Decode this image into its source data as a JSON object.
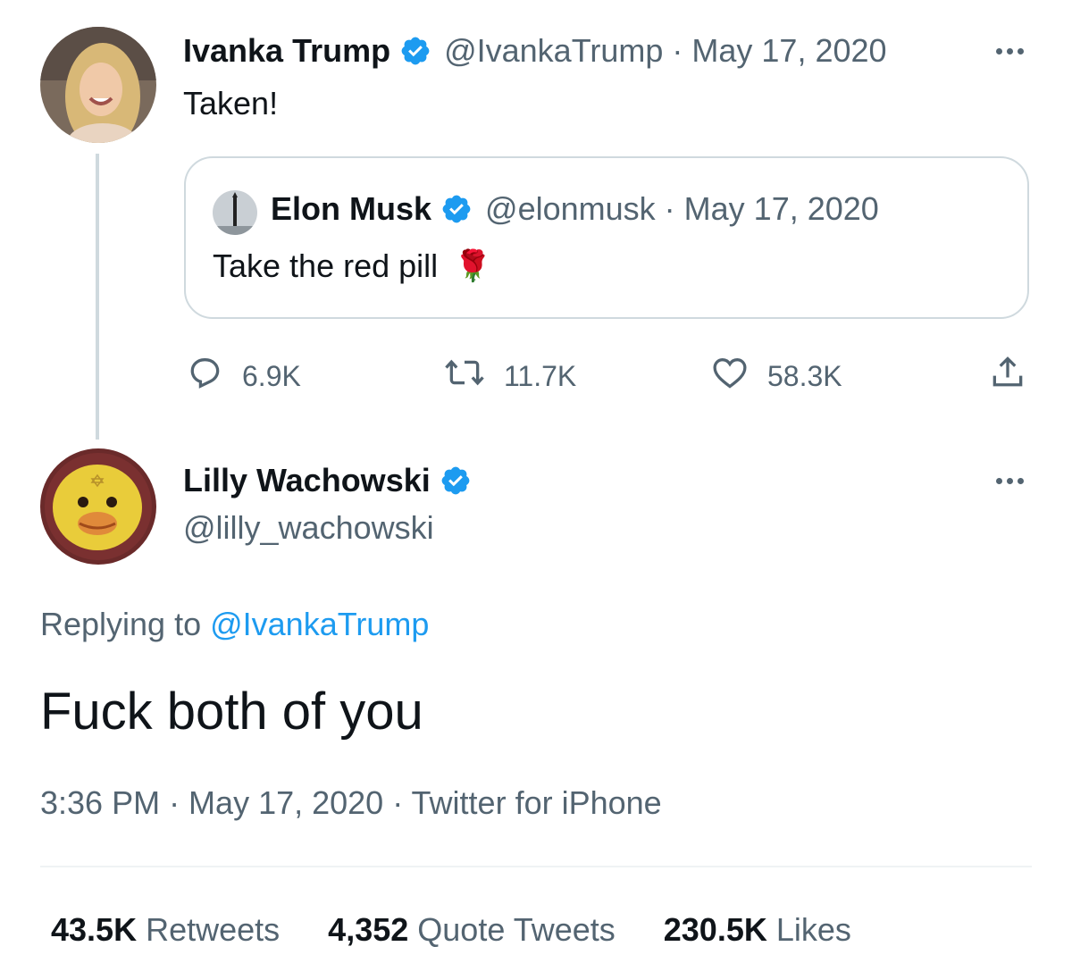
{
  "tweet_original": {
    "author_name": "Ivanka Trump",
    "handle": "@IvankaTrump",
    "separator": "·",
    "date": "May 17, 2020",
    "text": "Taken!",
    "quoted": {
      "author_name": "Elon Musk",
      "handle": "@elonmusk",
      "separator": "·",
      "date": "May 17, 2020",
      "text": "Take the red pill",
      "emoji": "🌹"
    },
    "actions": {
      "replies": "6.9K",
      "retweets": "11.7K",
      "likes": "58.3K"
    }
  },
  "tweet_reply": {
    "author_name": "Lilly Wachowski",
    "handle": "@lilly_wachowski",
    "replying_prefix": "Replying to ",
    "replying_to": "@IvankaTrump",
    "text": "Fuck both of you",
    "meta": "3:36 PM · May 17, 2020 · Twitter for iPhone",
    "stats": {
      "retweets_count": "43.5K",
      "retweets_label": "Retweets",
      "quotes_count": "4,352",
      "quotes_label": "Quote Tweets",
      "likes_count": "230.5K",
      "likes_label": "Likes"
    }
  },
  "colors": {
    "verified": "#1d9bf0",
    "link": "#1d9bf0",
    "muted": "#536471",
    "border": "#cfd9de"
  },
  "icons": [
    "verified-badge-icon",
    "more-icon",
    "reply-icon",
    "retweet-icon",
    "like-icon",
    "share-icon"
  ]
}
